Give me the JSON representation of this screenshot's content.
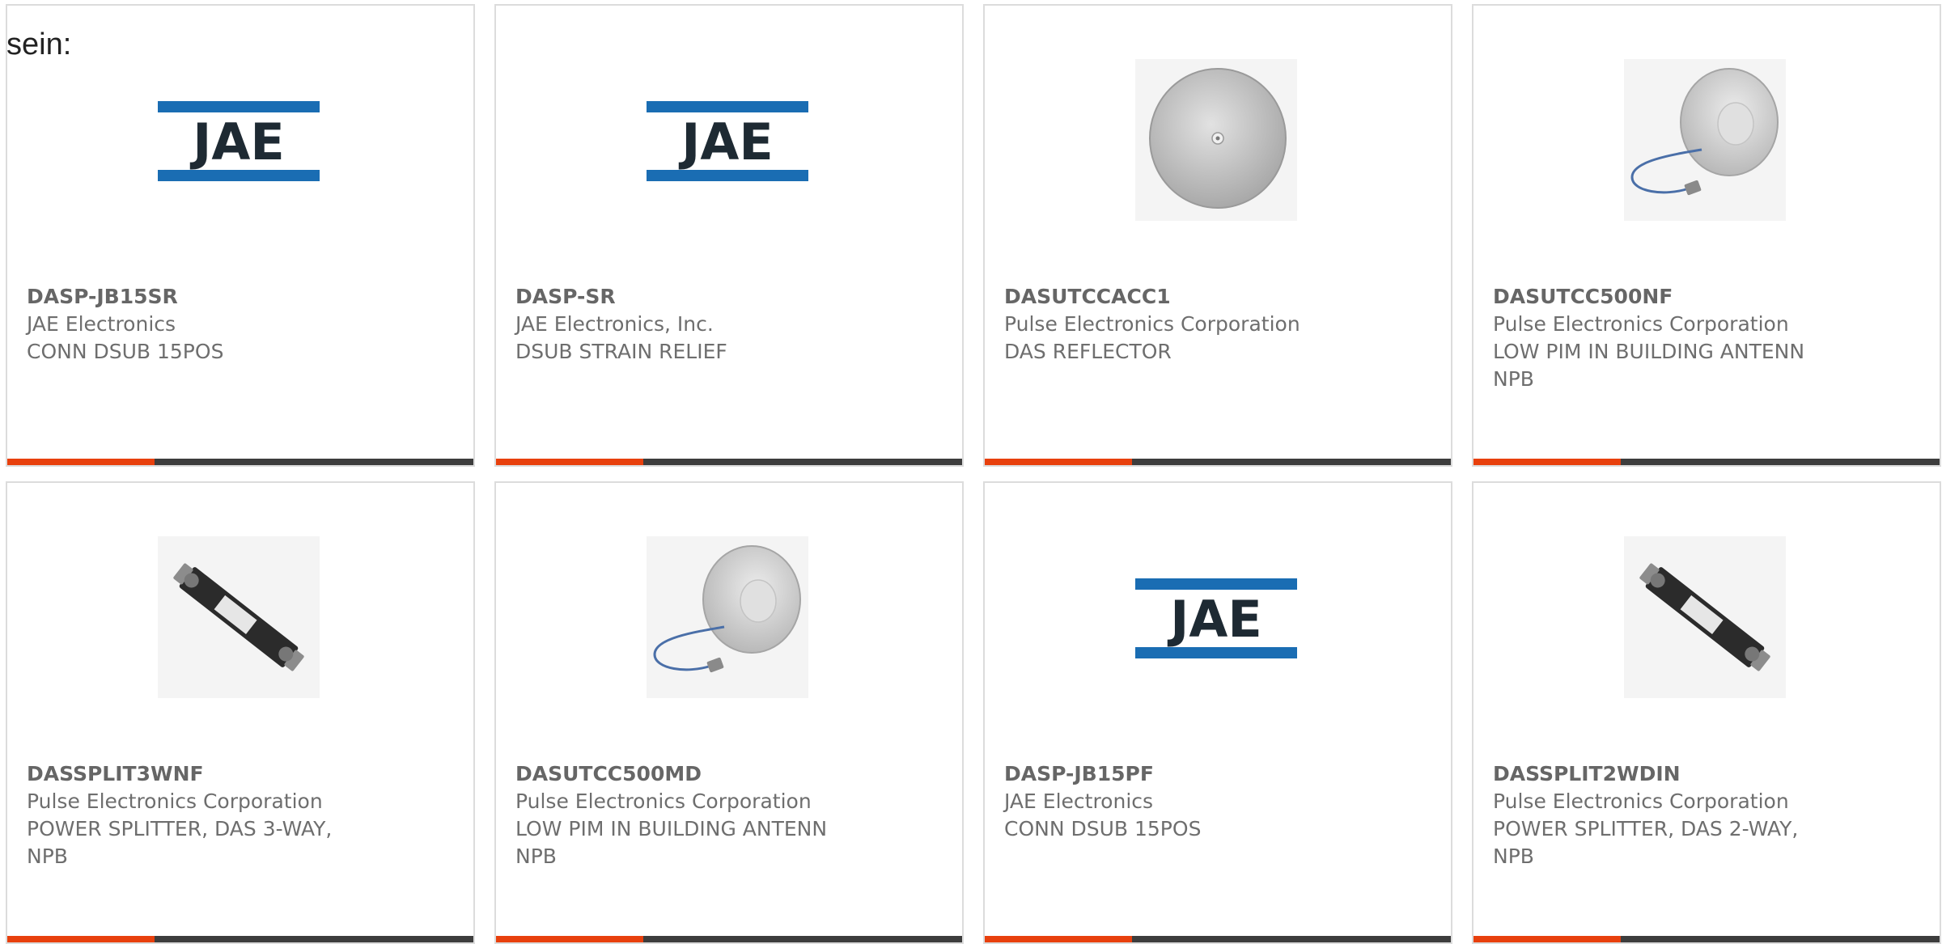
{
  "intro": "sein:",
  "colors": {
    "accent": "#e8400d",
    "bar": "#3d3d3d",
    "jae_blue": "#1a6db3"
  },
  "products": [
    {
      "part": "DASP-JB15SR",
      "manufacturer": "JAE Electronics",
      "description": "CONN DSUB 15POS",
      "image": "jae-logo"
    },
    {
      "part": "DASP-SR",
      "manufacturer": "JAE Electronics, Inc.",
      "description": "DSUB STRAIN RELIEF",
      "image": "jae-logo"
    },
    {
      "part": "DASUTCCACC1",
      "manufacturer": "Pulse Electronics Corporation",
      "description": "DAS REFLECTOR",
      "image": "reflector-disc"
    },
    {
      "part": "DASUTCC500NF",
      "manufacturer": "Pulse Electronics Corporation",
      "description": "LOW PIM IN BUILDING ANTENN NPB",
      "image": "dome-antenna-left"
    },
    {
      "part": "DASSPLIT3WNF",
      "manufacturer": "Pulse Electronics Corporation",
      "description": "POWER SPLITTER, DAS 3-WAY, NPB",
      "image": "power-splitter"
    },
    {
      "part": "DASUTCC500MD",
      "manufacturer": "Pulse Electronics Corporation",
      "description": "LOW PIM IN BUILDING ANTENN NPB",
      "image": "dome-antenna-left"
    },
    {
      "part": "DASP-JB15PF",
      "manufacturer": "JAE Electronics",
      "description": "CONN DSUB 15POS",
      "image": "jae-logo"
    },
    {
      "part": "DASSPLIT2WDIN",
      "manufacturer": "Pulse Electronics Corporation",
      "description": "POWER SPLITTER, DAS 2-WAY, NPB",
      "image": "power-splitter"
    }
  ]
}
